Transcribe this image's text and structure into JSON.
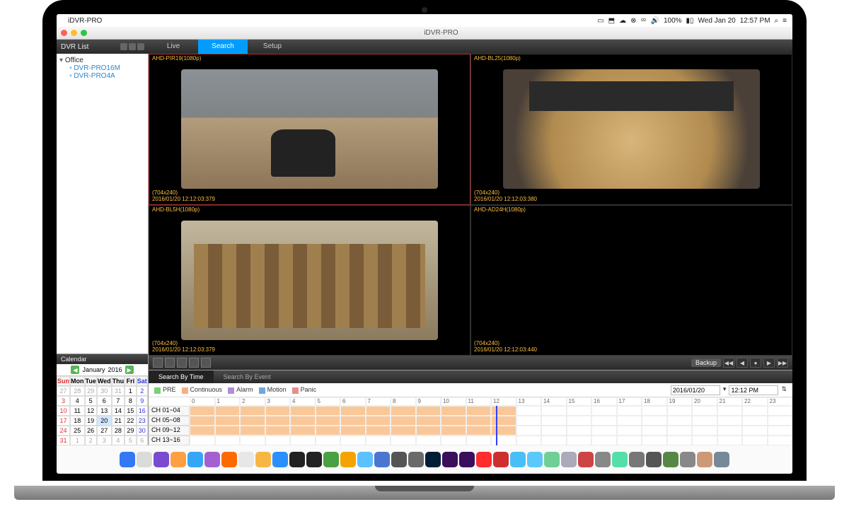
{
  "mac_menu": {
    "app_name": "iDVR-PRO",
    "battery": "100%",
    "date": "Wed Jan 20",
    "time": "12:57 PM"
  },
  "window": {
    "title": "iDVR-PRO"
  },
  "tabs": {
    "live": "Live",
    "search": "Search",
    "setup": "Setup",
    "active": "search"
  },
  "sidebar": {
    "header": "DVR List",
    "folder": "Office",
    "items": [
      "DVR-PRO16M",
      "DVR-PRO4A"
    ]
  },
  "calendar": {
    "header": "Calendar",
    "month_label": "January",
    "year_label": "2016",
    "days": [
      "Sun",
      "Mon",
      "Tue",
      "Wed",
      "Thu",
      "Fri",
      "Sat"
    ],
    "rows": [
      [
        "27",
        "28",
        "29",
        "30",
        "31",
        "1",
        "2"
      ],
      [
        "3",
        "4",
        "5",
        "6",
        "7",
        "8",
        "9"
      ],
      [
        "10",
        "11",
        "12",
        "13",
        "14",
        "15",
        "16"
      ],
      [
        "17",
        "18",
        "19",
        "20",
        "21",
        "22",
        "23"
      ],
      [
        "24",
        "25",
        "26",
        "27",
        "28",
        "29",
        "30"
      ],
      [
        "31",
        "1",
        "2",
        "3",
        "4",
        "5",
        "6"
      ]
    ],
    "today": "20"
  },
  "cameras": [
    {
      "name": "AHD-PIR19(1080p)",
      "res": "(704x240)",
      "ts": "2016/01/20 12:12:03:379"
    },
    {
      "name": "AHD-BL25(1080p)",
      "res": "(704x240)",
      "ts": "2016/01/20 12:12:03:380"
    },
    {
      "name": "AHD-BL5H(1080p)",
      "res": "(704x240)",
      "ts": "2016/01/20 12:12:03:379"
    },
    {
      "name": "AHD-AD24H(1080p)",
      "res": "(704x240)",
      "ts": "2016/01/20 12:12:03:440"
    }
  ],
  "controls": {
    "backup": "Backup",
    "playback": [
      "◀◀",
      "◀",
      "●",
      "▶",
      "▶▶"
    ]
  },
  "search": {
    "tab_time": "Search By Time",
    "tab_event": "Search By Event",
    "legend": [
      {
        "label": "PRE",
        "color": "#7bcf7b"
      },
      {
        "label": "Continuous",
        "color": "#f4b183"
      },
      {
        "label": "Alarm",
        "color": "#b38cd9"
      },
      {
        "label": "Motion",
        "color": "#6fa8dc"
      },
      {
        "label": "Panic",
        "color": "#e38f8f"
      }
    ],
    "date": "2016/01/20",
    "time": "12:12 PM",
    "channel_labels": [
      "CH 01~04",
      "CH 05~08",
      "CH 09~12",
      "CH 13~16"
    ],
    "hours": [
      "0",
      "1",
      "2",
      "3",
      "4",
      "5",
      "6",
      "7",
      "8",
      "9",
      "10",
      "11",
      "12",
      "13",
      "14",
      "15",
      "16",
      "17",
      "18",
      "19",
      "20",
      "21",
      "22",
      "23"
    ],
    "fill_end_hour": 13,
    "cursor_hour": 12.2
  },
  "dock_colors": [
    "#3478f6",
    "#dbdbdb",
    "#7a4bcf",
    "#ff9f43",
    "#34a6f6",
    "#a460d1",
    "#ff6a00",
    "#e7e7e7",
    "#f7b644",
    "#2b8fff",
    "#222",
    "#222",
    "#4aa043",
    "#f4a300",
    "#5dc0ff",
    "#4a76d1",
    "#555",
    "#6a6a6a",
    "#001e36",
    "#3a0f5c",
    "#3a0f5c",
    "#ff2d2d",
    "#cf2e2e",
    "#48c0f7",
    "#5ac8fa",
    "#6fcf97",
    "#aab",
    "#c44",
    "#888",
    "#5da",
    "#777",
    "#555",
    "#584",
    "#888",
    "#c97",
    "#789"
  ]
}
